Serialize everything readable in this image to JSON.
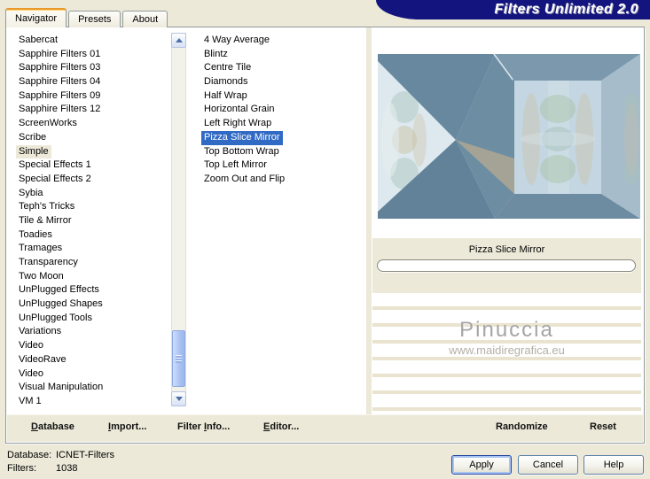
{
  "header": {
    "title": "Filters Unlimited 2.0"
  },
  "tabs": [
    {
      "label": "Navigator",
      "active": true
    },
    {
      "label": "Presets",
      "active": false
    },
    {
      "label": "About",
      "active": false
    }
  ],
  "left_list": {
    "items": [
      "Sabercat",
      "Sapphire Filters 01",
      "Sapphire Filters 03",
      "Sapphire Filters 04",
      "Sapphire Filters 09",
      "Sapphire Filters 12",
      "ScreenWorks",
      "Scribe",
      "Simple",
      "Special Effects 1",
      "Special Effects 2",
      "Sybia",
      "Teph's Tricks",
      "Tile & Mirror",
      "Toadies",
      "Tramages",
      "Transparency",
      "Two Moon",
      "UnPlugged Effects",
      "UnPlugged Shapes",
      "UnPlugged Tools",
      "Variations",
      "Video",
      "VideoRave",
      "Video",
      "Visual Manipulation",
      "VM 1"
    ],
    "selected": "Simple"
  },
  "filter_list": {
    "items": [
      "4 Way Average",
      "Blintz",
      "Centre Tile",
      "Diamonds",
      "Half Wrap",
      "Horizontal Grain",
      "Left Right Wrap",
      "Pizza Slice Mirror",
      "Top Bottom Wrap",
      "Top Left Mirror",
      "Zoom Out and Flip"
    ],
    "selected": "Pizza Slice Mirror"
  },
  "preview": {
    "label": "Pizza Slice Mirror",
    "watermark_name": "Pinuccia",
    "watermark_url": "www.maidiregrafica.eu"
  },
  "actions": {
    "database": {
      "label": "Database",
      "accel_index": 0
    },
    "import": {
      "label": "Import...",
      "accel_index": 0
    },
    "filter_info": {
      "label": "Filter Info...",
      "accel_index": 7
    },
    "editor": {
      "label": "Editor...",
      "accel_index": 0
    },
    "randomize": {
      "label": "Randomize",
      "accel_index": -1
    },
    "reset": {
      "label": "Reset",
      "accel_index": -1
    }
  },
  "status": {
    "database_label": "Database:",
    "database_value": "ICNET-Filters",
    "filters_label": "Filters:",
    "filters_value": "1038"
  },
  "dialog_buttons": {
    "apply": "Apply",
    "cancel": "Cancel",
    "help": "Help"
  },
  "colors": {
    "title_bar": "#14147e",
    "dialog_bg": "#ece9d8",
    "selection_focused": "#316ac5",
    "selection_unfocused": "#ece9d8",
    "tab_accent_orange": "#e8982c"
  }
}
